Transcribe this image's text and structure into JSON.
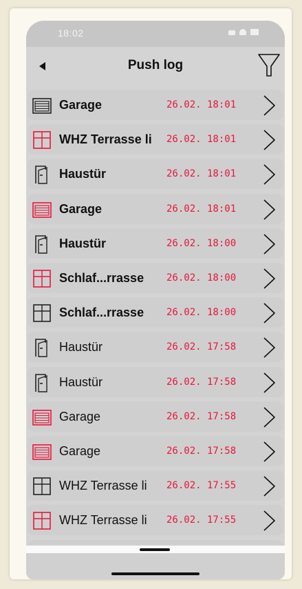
{
  "status_bar": {
    "time": "18:02"
  },
  "nav": {
    "title": "Push log"
  },
  "colors": {
    "accent_red": "#e8163a",
    "row_bg": "#cfcfcf",
    "icon_dark": "#222222",
    "icon_red": "#e8163a"
  },
  "log": [
    {
      "name": "Garage",
      "time": "26.02. 18:01",
      "icon": "garage-door-icon",
      "icon_color": "dark",
      "bold": true
    },
    {
      "name": "WHZ Terrasse li",
      "time": "26.02. 18:01",
      "icon": "window-icon",
      "icon_color": "red",
      "bold": true
    },
    {
      "name": "Haustür",
      "time": "26.02. 18:01",
      "icon": "door-icon",
      "icon_color": "dark",
      "bold": true
    },
    {
      "name": "Garage",
      "time": "26.02. 18:01",
      "icon": "garage-door-icon",
      "icon_color": "red",
      "bold": true
    },
    {
      "name": "Haustür",
      "time": "26.02. 18:00",
      "icon": "door-icon",
      "icon_color": "dark",
      "bold": true
    },
    {
      "name": "Schlaf...rrasse",
      "time": "26.02. 18:00",
      "icon": "window-icon",
      "icon_color": "red",
      "bold": true
    },
    {
      "name": "Schlaf...rrasse",
      "time": "26.02. 18:00",
      "icon": "window-icon",
      "icon_color": "dark",
      "bold": true
    },
    {
      "name": "Haustür",
      "time": "26.02. 17:58",
      "icon": "door-icon",
      "icon_color": "dark",
      "bold": false
    },
    {
      "name": "Haustür",
      "time": "26.02. 17:58",
      "icon": "door-icon",
      "icon_color": "dark",
      "bold": false
    },
    {
      "name": "Garage",
      "time": "26.02. 17:58",
      "icon": "garage-door-icon",
      "icon_color": "red",
      "bold": false
    },
    {
      "name": "Garage",
      "time": "26.02. 17:58",
      "icon": "garage-door-icon",
      "icon_color": "red",
      "bold": false
    },
    {
      "name": "WHZ Terrasse li",
      "time": "26.02. 17:55",
      "icon": "window-icon",
      "icon_color": "dark",
      "bold": false
    },
    {
      "name": "WHZ Terrasse li",
      "time": "26.02. 17:55",
      "icon": "window-icon",
      "icon_color": "red",
      "bold": false
    },
    {
      "name": "",
      "time": "",
      "icon": "window-icon",
      "icon_color": "dark",
      "bold": false
    }
  ]
}
